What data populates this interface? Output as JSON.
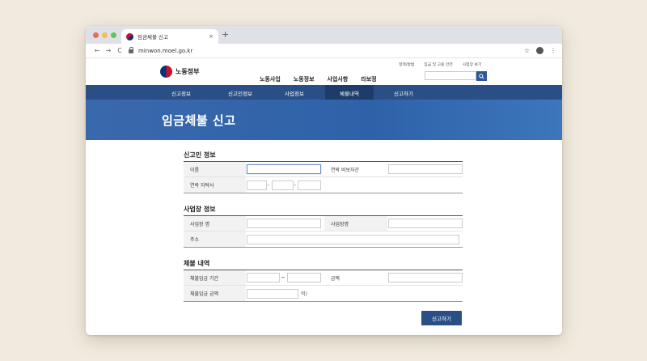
{
  "browser": {
    "tab_title": "임금체불 신고",
    "tab_close": "×",
    "new_tab": "+",
    "url": "minwon.moel.go.kr",
    "nav": {
      "back": "←",
      "forward": "→",
      "reload": "C"
    },
    "star": "☆",
    "menu": "⋮"
  },
  "header": {
    "logo_text": "노동정부",
    "gnb": [
      "노동사업",
      "노동정보",
      "사업사항",
      "라보정"
    ],
    "util": [
      "정책/방법",
      "임금 및 고용 안전",
      "사업장 보기"
    ]
  },
  "subnav": {
    "items": [
      "신고정보",
      "신고인정보",
      "사업정보",
      "체불내역",
      "신고하기"
    ],
    "active_index": 3
  },
  "banner": {
    "title": "임금체불 신고"
  },
  "form": {
    "reporter": {
      "title": "신고인 정보",
      "name_label": "이름",
      "contact_time_label": "연락 비보자간",
      "contact_label": "연락 자탁사",
      "phone_sep": "-"
    },
    "workplace": {
      "title": "사업장 정보",
      "biz_name_label": "사업장 명",
      "biz_rep_label": "사업장명",
      "address_label": "주소"
    },
    "arrears": {
      "title": "체불 내역",
      "period_label": "체불임금 기간",
      "period_sep": "~",
      "amount_label": "금액",
      "total_label": "체불임금 금액",
      "total_unit": "억)"
    },
    "submit_label": "신고하기"
  },
  "colors": {
    "primary": "#2a4f86",
    "banner": "#3366aa",
    "background": "#f1ebdf"
  }
}
